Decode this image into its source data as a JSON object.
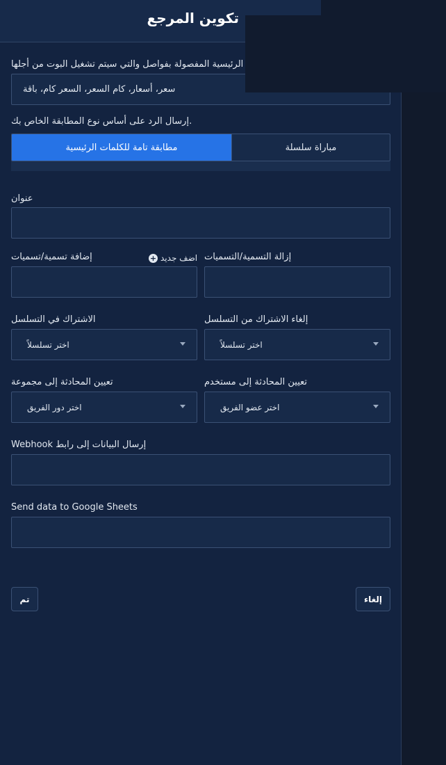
{
  "header": {
    "title": "تكوين المرجع"
  },
  "keywords": {
    "label": "الرئيسية المفصولة بفواصل والتي سيتم تشغيل البوت من أجلها",
    "value": "سعر، أسعار، كام السعر، السعر كام، باقة"
  },
  "match_type": {
    "label": ".إرسال الرد على أساس نوع المطابقة الخاص بك",
    "options": [
      "مطابقة تامة للكلمات الرئيسية",
      "مباراة سلسلة"
    ],
    "selected": "مطابقة تامة للكلمات الرئيسية"
  },
  "title_field": {
    "label": "عنوان",
    "value": ""
  },
  "labels": {
    "add_label": "إضافة تسمية/تسميات",
    "add_new": "اضف جديد",
    "remove_label": "إزالة التسمية/التسميات"
  },
  "sequence": {
    "subscribe_label": "الاشتراك في التسلسل",
    "subscribe_value": "اختر تسلسلاً",
    "unsubscribe_label": "إلغاء الاشتراك من التسلسل",
    "unsubscribe_value": "اختر تسلسلاً"
  },
  "assign": {
    "group_label": "تعيين المحادثة إلى مجموعة",
    "group_value": "اختر دور الفريق",
    "user_label": "تعيين المحادثة إلى مستخدم",
    "user_value": "اختر عضو الفريق"
  },
  "webhook": {
    "label": "إرسال البيانات إلى رابط Webhook",
    "value": ""
  },
  "google_sheets": {
    "label": "Send data to Google Sheets",
    "value": ""
  },
  "buttons": {
    "done": "تم",
    "cancel": "إلغاء"
  },
  "colors": {
    "panel": "#132340",
    "accent": "#2673e6",
    "border": "#3b5175"
  }
}
